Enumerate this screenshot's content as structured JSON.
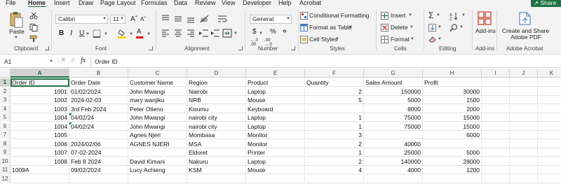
{
  "menu": {
    "tabs": [
      "File",
      "Home",
      "Insert",
      "Draw",
      "Page Layout",
      "Formulas",
      "Data",
      "Review",
      "View",
      "Developer",
      "Help",
      "Acrobat"
    ],
    "active_tab": "Home",
    "share_label": "Share"
  },
  "ribbon": {
    "clipboard": {
      "paste_label": "Paste",
      "group_label": "Clipboard"
    },
    "font": {
      "font_name": "Calibri",
      "font_size": "11",
      "group_label": "Font"
    },
    "alignment": {
      "group_label": "Alignment"
    },
    "number": {
      "format": "General",
      "group_label": "Number"
    },
    "styles": {
      "conditional_formatting": "Conditional Formatting",
      "format_as_table": "Format as Table",
      "cell_styles": "Cell Styles",
      "group_label": "Styles"
    },
    "cells": {
      "insert": "Insert",
      "delete": "Delete",
      "format": "Format",
      "group_label": "Cells"
    },
    "editing": {
      "group_label": "Editing"
    },
    "addins": {
      "button_label": "Add-ins",
      "group_label": "Add-ins"
    },
    "acrobat": {
      "create_share_line1": "Create and Share",
      "create_share_line2": "Adobe PDF",
      "group_label": "Adobe Acrobat"
    }
  },
  "formula_bar": {
    "cell_ref": "A1",
    "fx_label": "fx",
    "content": "Order ID"
  },
  "columns": [
    "A",
    "B",
    "C",
    "D",
    "E",
    "F",
    "G",
    "H",
    "I",
    "J",
    "K"
  ],
  "rows": [
    {
      "n": "1",
      "cells": [
        "Order ID",
        "Order Date",
        "Customer Name",
        "Region",
        "Product",
        "Quantity",
        "Sales Amount",
        "Profit",
        "",
        "",
        ""
      ]
    },
    {
      "n": "2",
      "cells": [
        "1001",
        "01/02/2024",
        "John Mwangi",
        "Nairobi",
        "Laptop",
        "2",
        "150000",
        "30000",
        "",
        "",
        ""
      ]
    },
    {
      "n": "3",
      "cells": [
        "1002",
        "2024-02-03",
        "mary wanjiku",
        "NRB",
        "Mouse",
        "5",
        "5000",
        "1500",
        "",
        "",
        ""
      ]
    },
    {
      "n": "4",
      "cells": [
        "1003",
        "3rd Feb 2024",
        "Peter Otieno",
        "Kisumu",
        "Keyboard",
        "",
        "8000",
        "2000",
        "",
        "",
        ""
      ]
    },
    {
      "n": "5",
      "cells": [
        "1004",
        "04/02/24",
        "John Mwangi",
        "nairobi city",
        "Laptop",
        "1",
        "75000",
        "15000",
        "",
        "",
        ""
      ]
    },
    {
      "n": "6",
      "cells": [
        "1004",
        "04/02/24",
        "John Mwangi",
        "nairobi city",
        "Laptop",
        "1",
        "75000",
        "15000",
        "",
        "",
        ""
      ]
    },
    {
      "n": "7",
      "cells": [
        "1005",
        "",
        "Agnes Njeri",
        "Mombasa",
        "Monitor",
        "3",
        "",
        "6000",
        "",
        "",
        ""
      ]
    },
    {
      "n": "8",
      "cells": [
        "1006",
        "2024/02/06",
        "AGNES NJERI",
        "MSA",
        "Monitor",
        "2",
        "40000",
        "",
        "",
        "",
        ""
      ]
    },
    {
      "n": "9",
      "cells": [
        "1007",
        "07-02-2024",
        "",
        "Eldoret",
        "Printer",
        "1",
        "25000",
        "5000",
        "",
        "",
        ""
      ]
    },
    {
      "n": "10",
      "cells": [
        "1008",
        "Feb 8 2024",
        "David Kimani",
        "Nakuru",
        "Laptop",
        "2",
        "140000",
        "28000",
        "",
        "",
        ""
      ]
    },
    {
      "n": "11",
      "cells": [
        "1009A",
        "09/02/2024",
        "Lucy Achieng",
        "KSM",
        "Mouse",
        "4",
        "4000",
        "1200",
        "",
        "",
        ""
      ]
    },
    {
      "n": "12",
      "cells": [
        "",
        "",
        "",
        "",
        "",
        "",
        "",
        "",
        "",
        "",
        ""
      ]
    }
  ],
  "colors": {
    "accent": "#1e7145",
    "header_bg": "#f3f3f3",
    "selected_header": "#d2d2d2"
  }
}
